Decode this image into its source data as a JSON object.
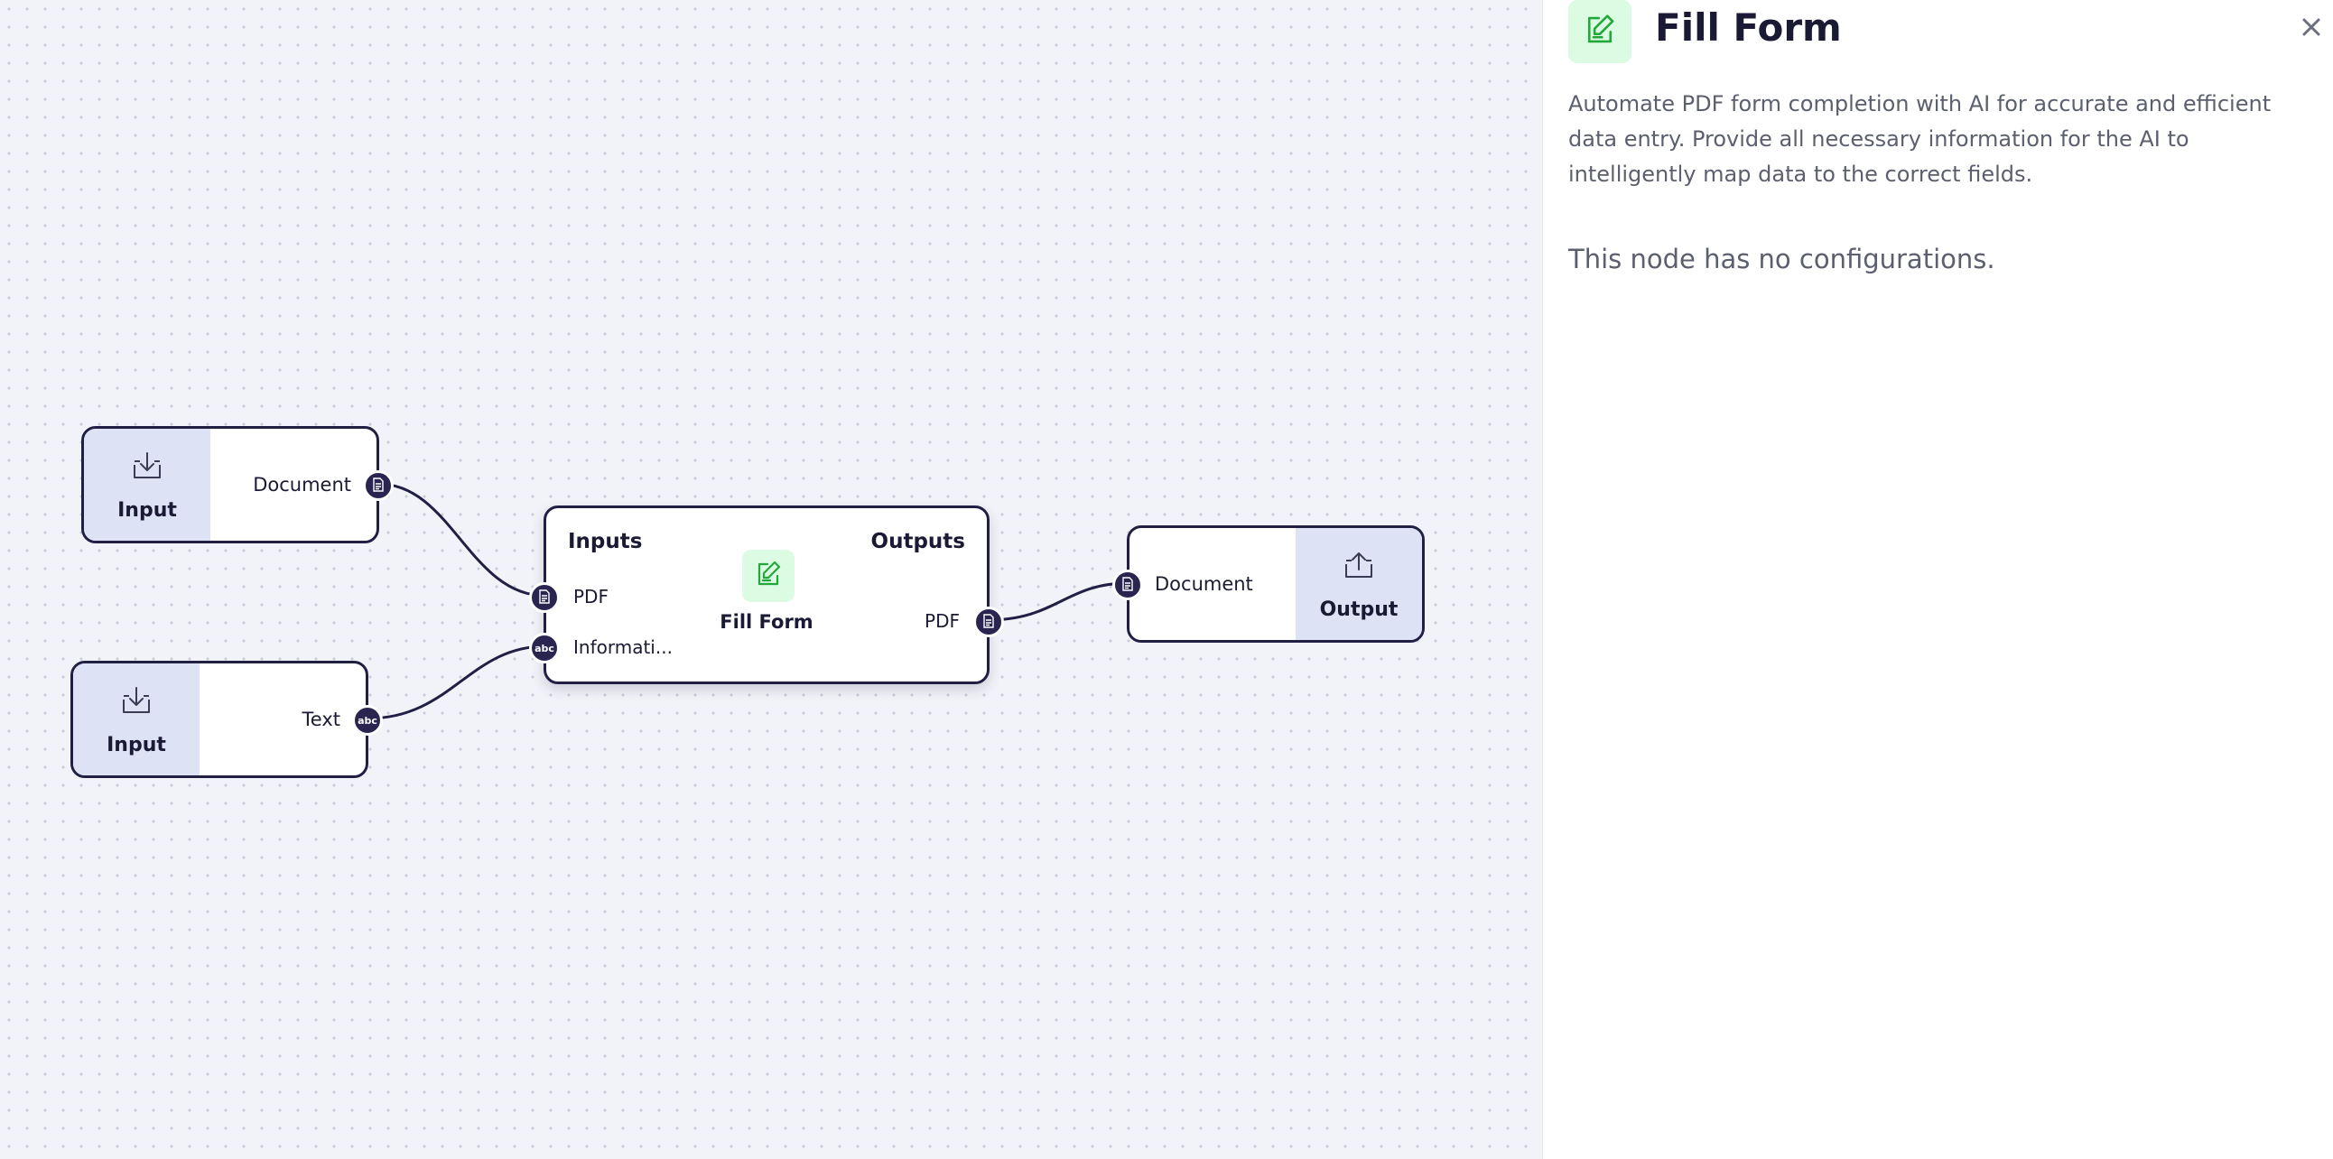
{
  "canvas": {
    "input_document_node": {
      "title": "Input",
      "output_label": "Document",
      "icon": "download-icon",
      "port_icon": "document-icon"
    },
    "input_text_node": {
      "title": "Input",
      "output_label": "Text",
      "icon": "download-icon",
      "port_glyph": "abc"
    },
    "fill_form_node": {
      "inputs_header": "Inputs",
      "outputs_header": "Outputs",
      "name": "Fill Form",
      "icon": "edit-form-icon",
      "inputs": [
        {
          "label": "PDF",
          "port_icon": "document-icon"
        },
        {
          "label": "Informati...",
          "port_glyph": "abc"
        }
      ],
      "outputs": [
        {
          "label": "PDF",
          "port_icon": "document-icon"
        }
      ]
    },
    "output_node": {
      "title": "Output",
      "input_label": "Document",
      "icon": "upload-icon",
      "port_icon": "document-icon"
    }
  },
  "panel": {
    "title": "Fill Form",
    "icon": "edit-form-icon",
    "description": "Automate PDF form completion with AI for accurate and efficient data entry. Provide all necessary information for the AI to intelligently map data to the correct fields.",
    "note": "This node has no configurations.",
    "close_icon": "close-icon"
  },
  "colors": {
    "node_border": "#221f45",
    "io_side": "#dde2f5",
    "port": "#2a2550",
    "accent_green": "#22a83a",
    "green_badge_bg": "#dcfbe3"
  }
}
